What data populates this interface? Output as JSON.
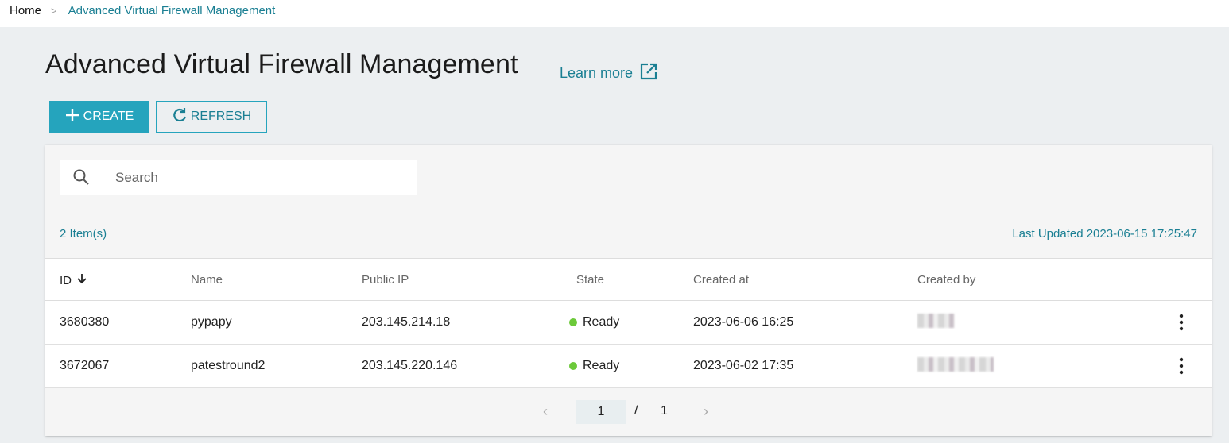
{
  "breadcrumb": {
    "home": "Home",
    "separator": ">",
    "current": "Advanced Virtual Firewall Management"
  },
  "page": {
    "title": "Advanced Virtual Firewall Management",
    "learn_more": "Learn more"
  },
  "toolbar": {
    "create_label": "CREATE",
    "refresh_label": "REFRESH"
  },
  "search": {
    "placeholder": "Search",
    "value": ""
  },
  "summary": {
    "item_count": "2 Item(s)",
    "last_updated": "Last Updated 2023-06-15 17:25:47"
  },
  "table": {
    "headers": {
      "id": "ID",
      "name": "Name",
      "public_ip": "Public IP",
      "state": "State",
      "created_at": "Created at",
      "created_by": "Created by"
    },
    "rows": [
      {
        "id": "3680380",
        "name": "pypapy",
        "public_ip": "203.145.214.18",
        "state": "Ready",
        "created_at": "2023-06-06 16:25"
      },
      {
        "id": "3672067",
        "name": "patestround2",
        "public_ip": "203.145.220.146",
        "state": "Ready",
        "created_at": "2023-06-02 17:35"
      }
    ]
  },
  "pagination": {
    "current": "1",
    "slash": "/",
    "total": "1"
  },
  "colors": {
    "accent": "#25a4bd",
    "link": "#1a7f93",
    "ready": "#6cc93a"
  },
  "icons": [
    "external-link-icon",
    "plus-icon",
    "refresh-icon",
    "search-icon",
    "arrow-down-icon",
    "kebab-icon",
    "chevron-left-icon",
    "chevron-right-icon"
  ]
}
